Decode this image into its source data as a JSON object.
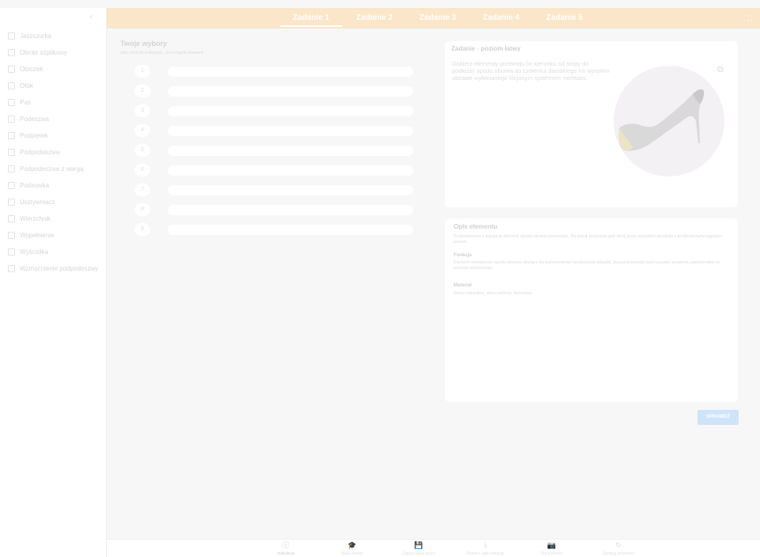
{
  "sidebar": {
    "collapse_icon": "chevron-left-icon",
    "items": [
      {
        "label": "Jaszczurka"
      },
      {
        "label": "Obcas szpilkowy"
      },
      {
        "label": "Otoczek"
      },
      {
        "label": "Otok"
      },
      {
        "label": "Pas"
      },
      {
        "label": "Podeszwa"
      },
      {
        "label": "Podpiętek"
      },
      {
        "label": "Podpodeszwa"
      },
      {
        "label": "Podpodeszwa z wargą"
      },
      {
        "label": "Podsuwka"
      },
      {
        "label": "Usztywniacz"
      },
      {
        "label": "Wierzchnik"
      },
      {
        "label": "Wypełnienie"
      },
      {
        "label": "Wyściółka"
      },
      {
        "label": "Wzmocnienie podpodeszwy"
      }
    ]
  },
  "header": {
    "tabs": [
      {
        "label": "Zadanie 1",
        "active": true
      },
      {
        "label": "Zadanie 2",
        "active": false
      },
      {
        "label": "Zadanie 3",
        "active": false
      },
      {
        "label": "Zadanie 4",
        "active": false
      },
      {
        "label": "Zadanie 5",
        "active": false
      }
    ],
    "fullscreen_icon": "fullscreen-icon"
  },
  "choices": {
    "title": "Twoje wybory",
    "subtitle": "Aby zmienić kolejność, przeciągnij element",
    "slots": [
      "1",
      "2",
      "3",
      "4",
      "5",
      "6",
      "7",
      "8",
      "9"
    ]
  },
  "task": {
    "title": "Zadanie - poziom łatwy",
    "description": "Dobierz elementy przekroju (w kierunku od stopy do podłoża) spodu obuwia do czółenka damskiego na wysokim obcasie wykonanego klejonym systemem montażu.",
    "open_icon": "external-link-icon",
    "image_icon": "high-heel-shoe-icon"
  },
  "element_description": {
    "title": "Opis elementu",
    "intro": "Podpodeszwa z wargą to element spodu obuwia pasowego. Do wargi przyszyty jest skrój (przy rzymskim łączeniu z podbrzeżnym/zagiętym pasem.",
    "function_heading": "Funkcja",
    "function_text": "Element montażowy spodu obuwia, służący do wzmocnienia i wydłużenia wkładki, przeznaczonego pod mocnej i powinna, wytrzymałej na procesy sztucznego.",
    "material_heading": "Materiał",
    "material_text": "Skóry naturalne, skóry wtórne, tworzywa"
  },
  "check_button": {
    "label": "SPRAWDŹ"
  },
  "toolbar": {
    "items": [
      {
        "label": "Instrukcja",
        "icon": "info-icon",
        "glyph": "ⓘ"
      },
      {
        "label": "Baza wiedzy",
        "icon": "graduation-cap-icon",
        "glyph": "🎓"
      },
      {
        "label": "Zapisz stany pracy",
        "icon": "save-icon",
        "glyph": "💾"
      },
      {
        "label": "Pobierz całą kolekcję",
        "icon": "download-icon",
        "glyph": "⭳"
      },
      {
        "label": "Zrzut ekranu",
        "icon": "camera-icon",
        "glyph": "📷"
      },
      {
        "label": "Spróbuj ponownie",
        "icon": "refresh-icon",
        "glyph": "↻"
      }
    ]
  },
  "colors": {
    "header_bg": "#fbe6c9",
    "accent_button": "#cfe3fb",
    "page_bg": "#f7f7f7"
  }
}
